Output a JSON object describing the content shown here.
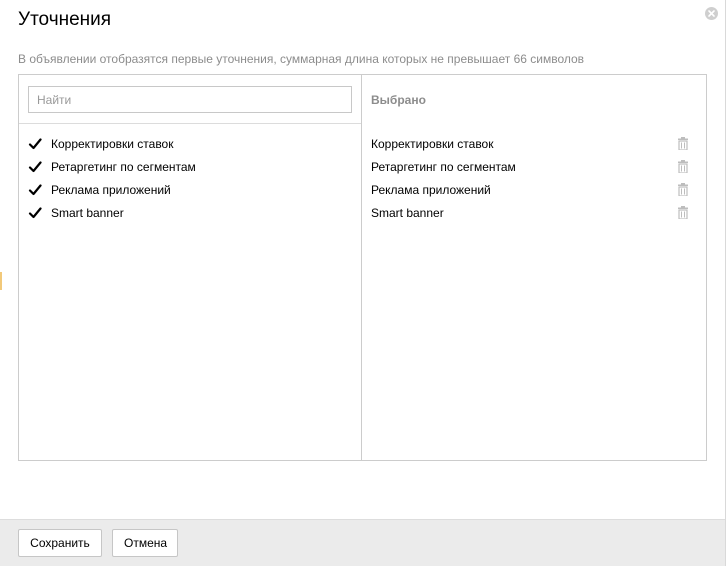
{
  "dialog": {
    "title": "Уточнения",
    "hint": "В объявлении отобразятся первые уточнения, суммарная длина которых не превышает 66 символов"
  },
  "search": {
    "placeholder": "Найти",
    "value": ""
  },
  "options": [
    {
      "label": "Корректировки ставок",
      "checked": true
    },
    {
      "label": "Ретаргетинг по сегментам",
      "checked": true
    },
    {
      "label": "Реклама приложений",
      "checked": true
    },
    {
      "label": "Smart banner",
      "checked": true
    }
  ],
  "selected": {
    "header": "Выбрано",
    "items": [
      {
        "label": "Корректировки ставок"
      },
      {
        "label": "Ретаргетинг по сегментам"
      },
      {
        "label": "Реклама приложений"
      },
      {
        "label": "Smart banner"
      }
    ]
  },
  "footer": {
    "save_label": "Сохранить",
    "cancel_label": "Отмена"
  },
  "icons": {
    "close": "close-icon",
    "check": "check-icon",
    "trash": "trash-icon"
  },
  "colors": {
    "border": "#cccccc",
    "muted_text": "#8c8c8c",
    "footer_bg": "#ebebeb"
  }
}
